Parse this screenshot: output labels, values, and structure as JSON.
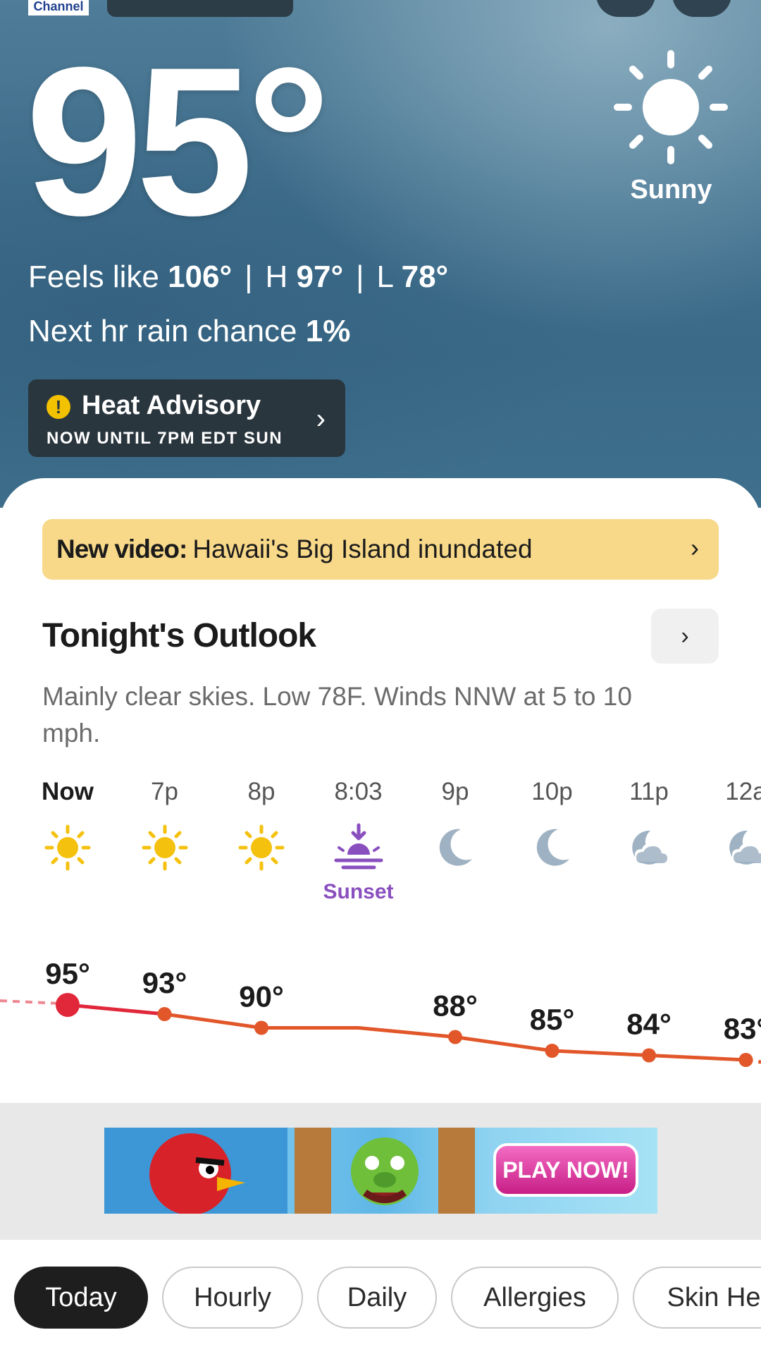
{
  "header": {
    "logo_text": "Channel"
  },
  "current": {
    "temperature": "95°",
    "condition": "Sunny",
    "feels_label": "Feels like",
    "feels_value": "106°",
    "separator": "|",
    "high_label": "H",
    "high_value": "97°",
    "low_label": "L",
    "low_value": "78°",
    "rain_label": "Next hr rain chance",
    "rain_value": "1%"
  },
  "advisory": {
    "icon": "!",
    "title": "Heat Advisory",
    "subtitle": "NOW UNTIL 7PM EDT SUN",
    "chevron": "›"
  },
  "video_banner": {
    "label": "New video:",
    "text": "Hawaii's Big Island inundated",
    "chevron": "›"
  },
  "outlook": {
    "title": "Tonight's Outlook",
    "chevron": "›",
    "text": "Mainly clear skies. Low 78F. Winds NNW at 5 to 10 mph."
  },
  "hourly": [
    {
      "label": "Now",
      "icon": "sun-icon",
      "temp": "95°"
    },
    {
      "label": "7p",
      "icon": "sun-icon",
      "temp": "93°"
    },
    {
      "label": "8p",
      "icon": "sun-icon",
      "temp": "90°"
    },
    {
      "label": "8:03",
      "icon": "sunset-icon",
      "temp": "",
      "note": "Sunset"
    },
    {
      "label": "9p",
      "icon": "moon-icon",
      "temp": "88°"
    },
    {
      "label": "10p",
      "icon": "moon-icon",
      "temp": "85°"
    },
    {
      "label": "11p",
      "icon": "moon-cloud-icon",
      "temp": "84°"
    },
    {
      "label": "12a",
      "icon": "moon-cloud-icon",
      "temp": "83°"
    }
  ],
  "ad": {
    "cta": "PLAY NOW!"
  },
  "tabs": [
    "Today",
    "Hourly",
    "Daily",
    "Allergies",
    "Skin He"
  ],
  "colors": {
    "accent_red": "#e0283a",
    "line_orange": "#e2572a",
    "sun_yellow": "#f5c10f",
    "sunset_purple": "#8a4fbf",
    "moon_grey": "#9fb2c3",
    "banner_yellow": "#f8d98a"
  }
}
